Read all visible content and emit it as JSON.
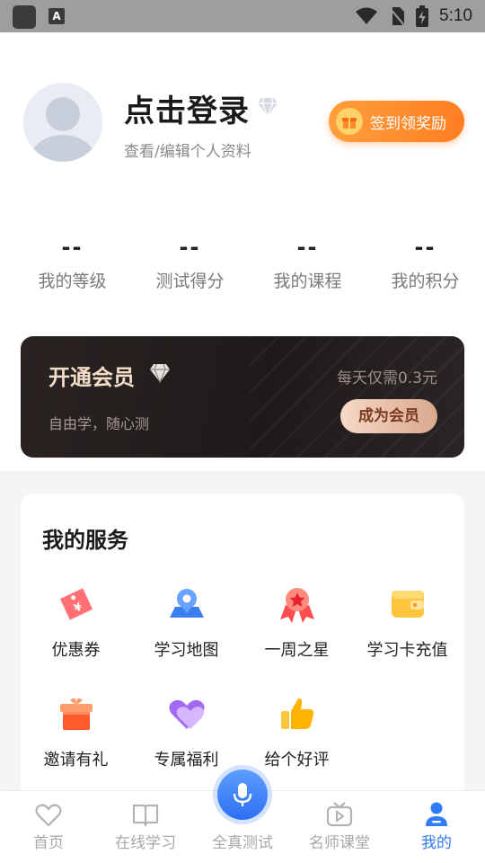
{
  "status_bar": {
    "time": "5:10",
    "icons": [
      "app-icon",
      "font-a-icon",
      "wifi-icon",
      "no-sim-icon",
      "battery-charging-icon"
    ],
    "small_icon_letter": "A"
  },
  "profile": {
    "title": "点击登录",
    "subtitle": "查看/编辑个人资料",
    "checkin_label": "签到领奖励"
  },
  "stats": [
    {
      "value": "--",
      "label": "我的等级"
    },
    {
      "value": "--",
      "label": "测试得分"
    },
    {
      "value": "--",
      "label": "我的课程"
    },
    {
      "value": "--",
      "label": "我的积分"
    }
  ],
  "vip": {
    "title": "开通会员",
    "subtitle": "自由学，随心测",
    "price": "每天仅需0.3元",
    "button": "成为会员"
  },
  "services": {
    "title": "我的服务",
    "items": [
      {
        "label": "优惠券",
        "icon": "coupon-icon"
      },
      {
        "label": "学习地图",
        "icon": "map-pin-icon"
      },
      {
        "label": "一周之星",
        "icon": "medal-icon"
      },
      {
        "label": "学习卡充值",
        "icon": "wallet-icon"
      },
      {
        "label": "邀请有礼",
        "icon": "gift-box-icon"
      },
      {
        "label": "专属福利",
        "icon": "heart-icon"
      },
      {
        "label": "给个好评",
        "icon": "thumbs-up-icon"
      }
    ]
  },
  "nav": [
    {
      "label": "首页",
      "icon": "heart-outline-icon"
    },
    {
      "label": "在线学习",
      "icon": "book-icon"
    },
    {
      "label": "全真测试",
      "icon": "microphone-icon"
    },
    {
      "label": "名师课堂",
      "icon": "tv-play-icon"
    },
    {
      "label": "我的",
      "icon": "user-icon"
    }
  ],
  "colors": {
    "accent": "#2f7cf6",
    "checkin": "#ff8a2a",
    "vip_bg": "#221c1b",
    "vip_gold": "#f3ddc8"
  }
}
